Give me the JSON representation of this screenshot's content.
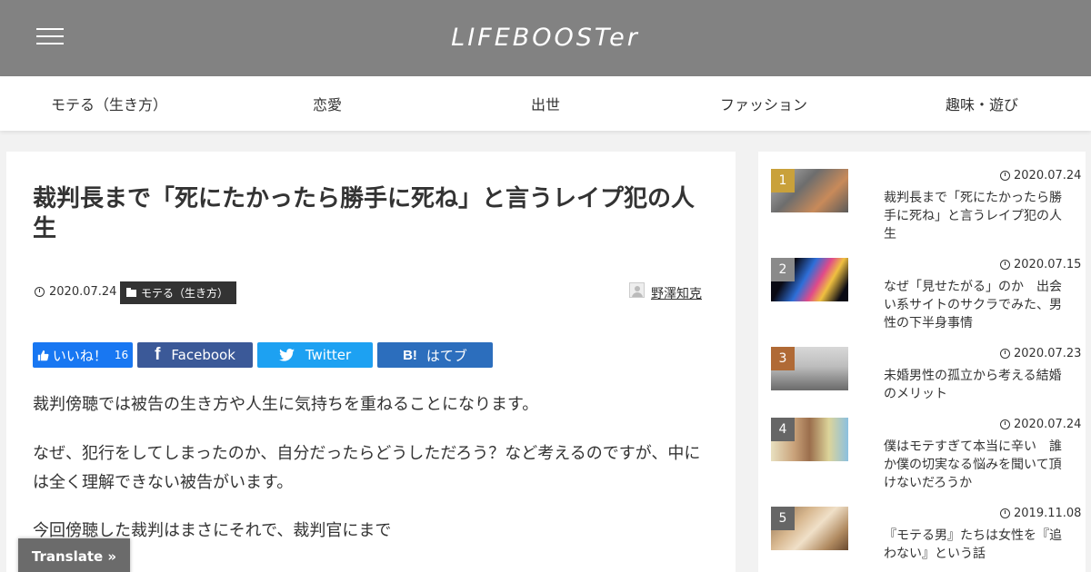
{
  "header": {
    "logo": "LIFEBOOSTer"
  },
  "nav": [
    "モテる（生き方）",
    "恋愛",
    "出世",
    "ファッション",
    "趣味・遊び"
  ],
  "article": {
    "title": "裁判長まで「死にたかったら勝手に死ね」と言うレイプ犯の人生",
    "date": "2020.07.24",
    "category": "モテる（生き方）",
    "author": "野澤知克",
    "share": {
      "like_label": "いいね！",
      "like_count": "16",
      "facebook": "Facebook",
      "twitter": "Twitter",
      "hatena": "はてブ",
      "hatena_mark": "B!"
    },
    "paragraphs": [
      "裁判傍聴では被告の生き方や人生に気持ちを重ねることになります。",
      "なぜ、犯行をしてしまったのか、自分だったらどうしただろう？など考えるのですが、中には全く理解できない被告がいます。",
      "今回傍聴した裁判はまさにそれで、裁判官にまで"
    ]
  },
  "ranking": [
    {
      "rank": "1",
      "date": "2020.07.24",
      "title": "裁判長まで「死にたかったら勝手に死ね」と言うレイプ犯の人生",
      "badge_color": "#c9a13b"
    },
    {
      "rank": "2",
      "date": "2020.07.15",
      "title": "なぜ「見せたがる」のか　出会い系サイトのサクラでみた、男性の下半身事情",
      "badge_color": "#8a8a8a"
    },
    {
      "rank": "3",
      "date": "2020.07.23",
      "title": "未婚男性の孤立から考える結婚のメリット",
      "badge_color": "#b06a36"
    },
    {
      "rank": "4",
      "date": "2020.07.24",
      "title": "僕はモテすぎて本当に辛い　誰か僕の切実なる悩みを聞いて頂けないだろうか",
      "badge_color": "#666666"
    },
    {
      "rank": "5",
      "date": "2019.11.08",
      "title": "『モテる男』たちは女性を『追わない』という話",
      "badge_color": "#666666"
    }
  ],
  "translate": "Translate »"
}
